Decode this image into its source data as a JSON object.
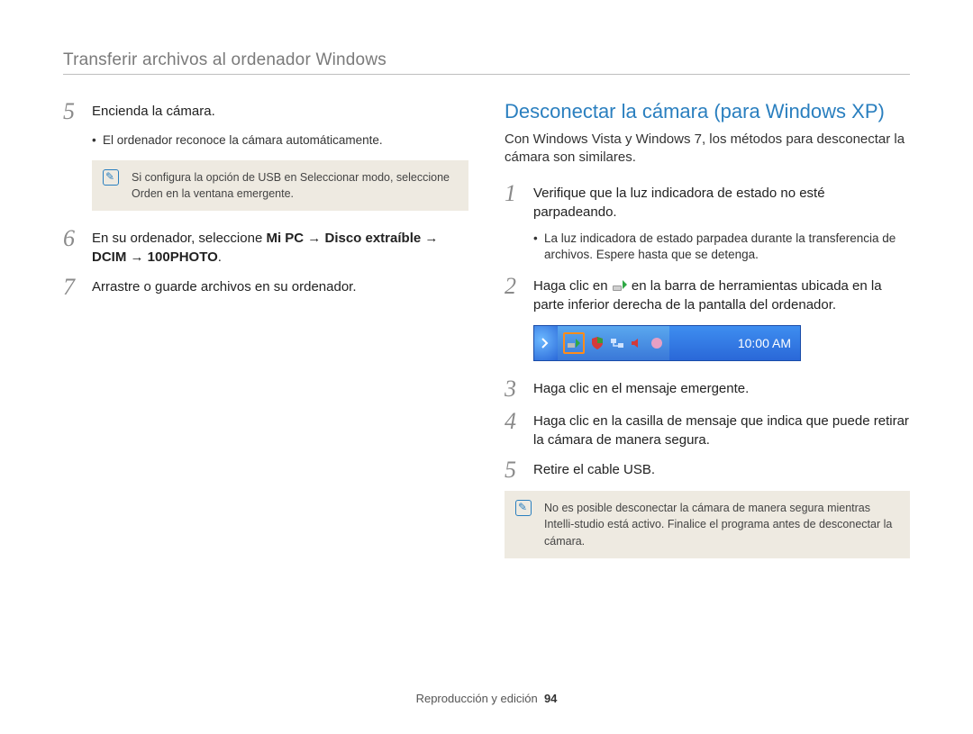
{
  "header": {
    "title": "Transferir archivos al ordenador Windows"
  },
  "left": {
    "steps": {
      "s5": {
        "num": "5",
        "text": "Encienda la cámara."
      },
      "s5_bullet": "El ordenador reconoce la cámara automáticamente.",
      "s5_note_pre": "Si configura la opción de USB en ",
      "s5_note_b1": "Seleccionar modo",
      "s5_note_mid": ", seleccione ",
      "s5_note_b2": "Orden",
      "s5_note_post": " en la ventana emergente.",
      "s6": {
        "num": "6",
        "pre": "En su ordenador, seleccione ",
        "b1": "Mi PC",
        "arrow1": " → ",
        "b2": "Disco extraíble",
        "arrow2": " → ",
        "b3": "DCIM",
        "arrow3": " → ",
        "b4": "100PHOTO",
        "post": "."
      },
      "s7": {
        "num": "7",
        "text": "Arrastre o guarde archivos en su ordenador."
      }
    }
  },
  "right": {
    "title": "Desconectar la cámara (para Windows XP)",
    "intro": "Con Windows Vista y Windows 7, los métodos para desconectar la cámara son similares.",
    "steps": {
      "s1": {
        "num": "1",
        "text": "Verifique que la luz indicadora de estado no esté parpadeando."
      },
      "s1_bullet": "La luz indicadora de estado parpadea durante la transferencia de archivos. Espere hasta que se detenga.",
      "s2": {
        "num": "2",
        "pre": "Haga clic en ",
        "post": " en la barra de herramientas ubicada en la parte inferior derecha de la pantalla del ordenador."
      },
      "s3": {
        "num": "3",
        "text": "Haga clic en el mensaje emergente."
      },
      "s4": {
        "num": "4",
        "text": "Haga clic en la casilla de mensaje que indica que puede retirar la cámara de manera segura."
      },
      "s5": {
        "num": "5",
        "text": "Retire el cable USB."
      }
    },
    "taskbar": {
      "clock": "10:00 AM"
    },
    "note2": "No es posible desconectar la cámara de manera segura mientras Intelli-studio está activo. Finalice el programa antes de desconectar la cámara."
  },
  "footer": {
    "section": "Reproducción y edición",
    "page": "94"
  },
  "colors": {
    "accent": "#2a7fbf"
  }
}
